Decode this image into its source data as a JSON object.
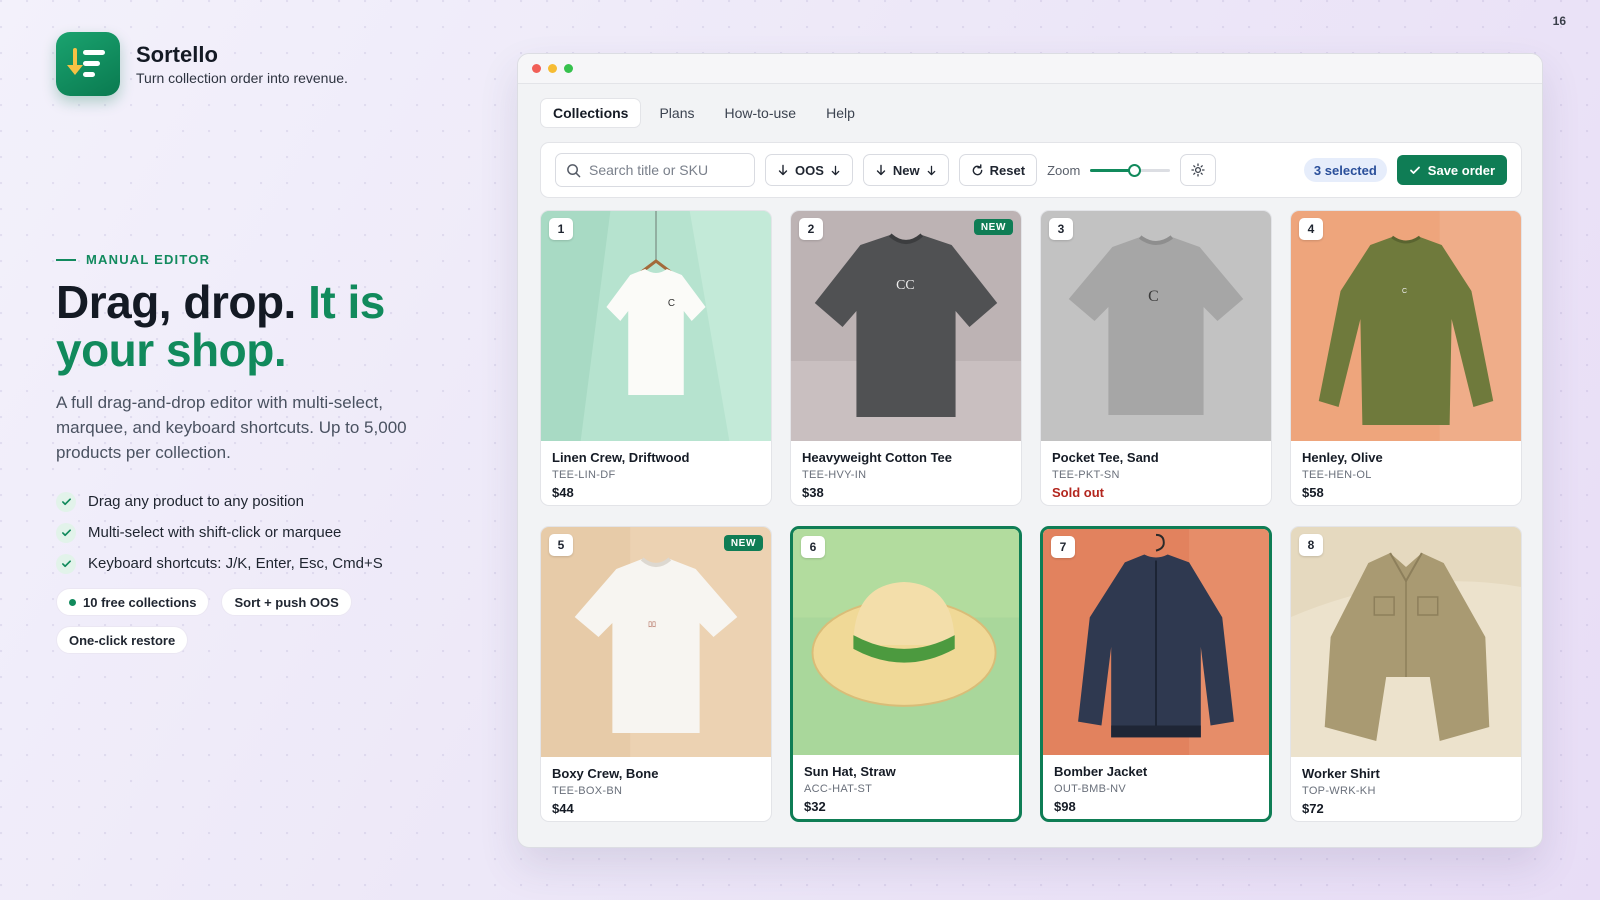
{
  "page_number": "16",
  "brand": {
    "name": "Sortello",
    "tagline": "Turn collection order into revenue."
  },
  "hero": {
    "eyebrow": "MANUAL EDITOR",
    "headline_part1": "Drag, drop.",
    "headline_accent": "It is your shop.",
    "lede": "A full drag-and-drop editor with multi-select, marquee, and keyboard shortcuts. Up to 5,000 products per collection.",
    "features": [
      "Drag any product to any position",
      "Multi-select with shift-click or marquee",
      "Keyboard shortcuts: J/K, Enter, Esc, Cmd+S"
    ],
    "pills": [
      "10 free collections",
      "Sort + push OOS",
      "One-click restore"
    ]
  },
  "colors": {
    "accent": "#118a5c",
    "save": "#0f7d55",
    "sold_out": "#b3261e",
    "selected_badge_bg": "#e6edfb"
  },
  "app": {
    "tabs": [
      "Collections",
      "Plans",
      "How-to-use",
      "Help"
    ],
    "active_tab": "Collections",
    "toolbar": {
      "search_placeholder": "Search title or SKU",
      "oos_label": "OOS",
      "new_label": "New",
      "reset_label": "Reset",
      "zoom_label": "Zoom",
      "zoom_level": 0.55,
      "selected_text": "3 selected",
      "save_label": "Save order"
    },
    "products": [
      {
        "pos": "1",
        "name": "Linen Crew, Driftwood",
        "sku": "TEE-LIN-DF",
        "price": "$48",
        "badge": "",
        "selected": false,
        "sold_out": false,
        "image": "white-tee-on-hanger"
      },
      {
        "pos": "2",
        "name": "Heavyweight Cotton Tee",
        "sku": "TEE-HVY-IN",
        "price": "$38",
        "badge": "NEW",
        "selected": false,
        "sold_out": false,
        "image": "charcoal-tee"
      },
      {
        "pos": "3",
        "name": "Pocket Tee, Sand",
        "sku": "TEE-PKT-SN",
        "price": "Sold out",
        "badge": "",
        "selected": false,
        "sold_out": true,
        "image": "grey-tee"
      },
      {
        "pos": "4",
        "name": "Henley, Olive",
        "sku": "TEE-HEN-OL",
        "price": "$58",
        "badge": "",
        "selected": false,
        "sold_out": false,
        "image": "olive-long-sleeve"
      },
      {
        "pos": "5",
        "name": "Boxy Crew, Bone",
        "sku": "TEE-BOX-BN",
        "price": "$44",
        "badge": "NEW",
        "selected": false,
        "sold_out": false,
        "image": "white-tee"
      },
      {
        "pos": "6",
        "name": "Sun Hat, Straw",
        "sku": "ACC-HAT-ST",
        "price": "$32",
        "badge": "",
        "selected": true,
        "sold_out": false,
        "image": "straw-hat"
      },
      {
        "pos": "7",
        "name": "Bomber Jacket",
        "sku": "OUT-BMB-NV",
        "price": "$98",
        "badge": "",
        "selected": true,
        "sold_out": false,
        "image": "navy-bomber"
      },
      {
        "pos": "8",
        "name": "Worker Shirt",
        "sku": "TOP-WRK-KH",
        "price": "$72",
        "badge": "",
        "selected": false,
        "sold_out": false,
        "image": "khaki-shirt"
      }
    ]
  }
}
